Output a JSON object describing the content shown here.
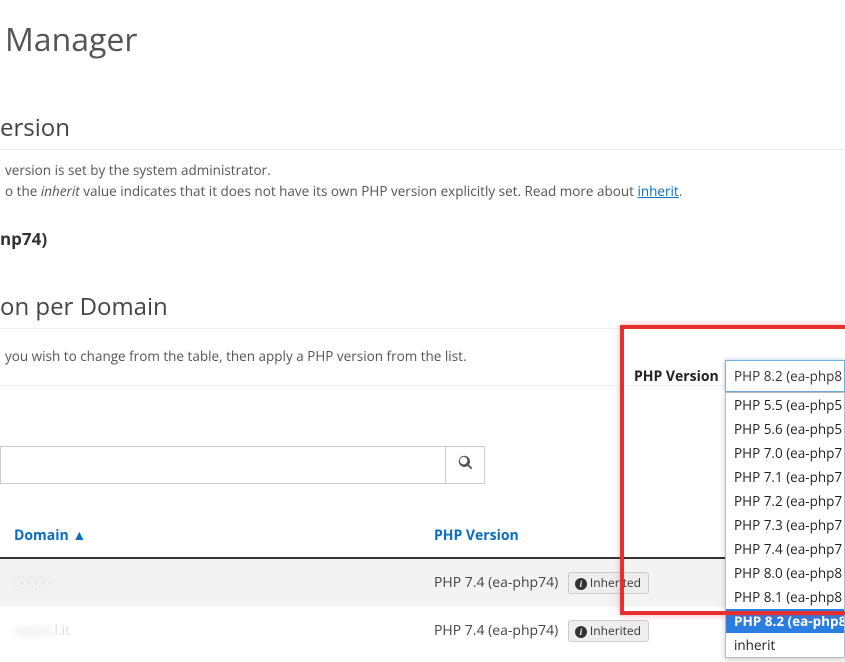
{
  "page": {
    "title": " Manager",
    "section1_title": "ersion",
    "desc_line1": " version is set by the system administrator.",
    "desc_line2a": "o the ",
    "desc_line2_em": "inherit",
    "desc_line2b": " value indicates that it does not have its own PHP version explicitly set. Read more about ",
    "desc_link": "inherit",
    "desc_line2c": ".",
    "sub_label": "np74)",
    "section2_title": "on per Domain",
    "instruction": " you wish to change from the table, then apply a PHP version from the list."
  },
  "search": {
    "placeholder": ""
  },
  "table": {
    "headers": {
      "domain": "Domain ▲",
      "php": "PHP Version"
    },
    "rows": [
      {
        "domain_blur": "xxxxx",
        "version": "PHP 7.4 (ea-php74)",
        "badge": "Inherited"
      },
      {
        "domain_blur": "xxxxx",
        "domain_suffix": ".l.it",
        "version": "PHP 7.4 (ea-php74)",
        "badge": "Inherited"
      }
    ]
  },
  "right_panel": {
    "label": "PHP Version",
    "selected": "PHP 8.2 (ea-php8",
    "options": [
      "PHP 5.5 (ea-php5",
      "PHP 5.6 (ea-php5",
      "PHP 7.0 (ea-php7",
      "PHP 7.1 (ea-php7",
      "PHP 7.2 (ea-php7",
      "PHP 7.3 (ea-php7",
      "PHP 7.4 (ea-php7",
      "PHP 8.0 (ea-php8",
      "PHP 8.1 (ea-php8",
      "PHP 8.2 (ea-php8",
      "inherit"
    ],
    "highlighted_index": 9
  }
}
